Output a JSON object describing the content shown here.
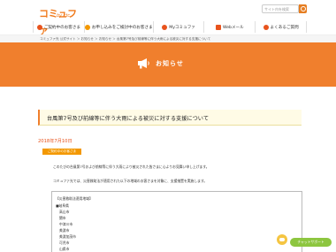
{
  "header": {
    "logo_text": "コミュファ",
    "logo_sub": "by ctc",
    "search_placeholder": "サイト内を検索"
  },
  "nav": [
    {
      "label": "ご契約中のお客さま"
    },
    {
      "label": "お申し込みをご検討中のお客さま"
    },
    {
      "label": "Myコミュファ"
    },
    {
      "label": "Webメール"
    },
    {
      "label": "よくあるご質問"
    }
  ],
  "breadcrumb": "コミュファ光 公式サイト ＞ お知らせ ＞ お知らせ ＞ 台風第7号及び前線等に伴う大雨による被災に対する支援について",
  "banner": {
    "title": "お知らせ"
  },
  "article": {
    "title": "台風第7号及び前線等に伴う大雨による被災に対する支援について",
    "date": "2018年7月10日",
    "category": "ご契約中のお客さま",
    "paragraph1": "このたびの台風第7号および前線等に伴う大雨により被災された皆さまに心よりお見舞い申し上げます。",
    "paragraph2": "コミュファ光では、災害救助法が適用された以下の地域のお客さまを対象に、支援措置を実施します。",
    "area_heading": "【災害救助法適用地域】",
    "pref": "■岐阜県",
    "cities": [
      "高山市",
      "関市",
      "中津川市",
      "美濃市",
      "美濃加茂市",
      "可児市",
      "山県市"
    ]
  },
  "support": {
    "label": "チャットサポート"
  }
}
